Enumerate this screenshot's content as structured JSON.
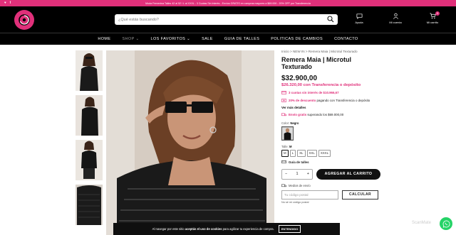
{
  "topbar": {
    "social": [
      "♥",
      "f"
    ],
    "promo": "Moda Femenina Talles 42 al 52 / L al XXXL - 3 Cuotas Sin Interés - Envíos GRATIS en compras mayores a $69.000 - 20% OFF por Transferencia"
  },
  "header": {
    "search_placeholder": "¿Qué estás buscando?",
    "help_label": "Ayuda",
    "account_label": "Mi cuenta",
    "cart_label": "Mi carrito",
    "cart_count": "0"
  },
  "nav": [
    "HOME",
    "SHOP",
    "LOS FAVORITOS",
    "SALE",
    "GUIA DE TALLES",
    "POLITICAS DE CAMBIOS",
    "CONTACTO"
  ],
  "product": {
    "breadcrumb": "Inicio  >  NEW IN  >  Remera Maia | Microtul Texturado",
    "title": "Remera Maia | Microtul Texturado",
    "price": "$32.900,00",
    "transfer_price": "$26.320,00 con Transferencia o depósito",
    "perk1_highlight": "3 cuotas sin interés de $10.966,67",
    "perk2_highlight": "20% de descuento",
    "perk2_text": " pagando con Transferencia o depósito",
    "more_details": "Ver más detalles",
    "perk3_highlight": "Envío gratis",
    "perk3_text": " superando los $69.000,00",
    "color_label": "Color:",
    "color_value": "Negro",
    "size_label": "Talle:",
    "size_value": "M",
    "sizes": [
      "M",
      "L",
      "XL",
      "XXL",
      "XXXL"
    ],
    "size_guide": "Guía de talles",
    "qty": "1",
    "add_to_cart": "AGREGAR AL CARRITO",
    "shipping_label": "Medios de envío",
    "postal_placeholder": "Tu código postal",
    "calc_button": "CALCULAR",
    "no_postal": "No sé mi código postal"
  },
  "cookie": {
    "text_pre": "Al navegar por este sitio ",
    "text_bold": "aceptás el uso de cookies",
    "text_post": " para agilizar tu experiencia de compra.",
    "button": "ENTENDIDO"
  },
  "scanmate": "ScanMate",
  "colors": {
    "brand": "#e0307a",
    "header": "#000000",
    "whatsapp": "#25d366"
  }
}
